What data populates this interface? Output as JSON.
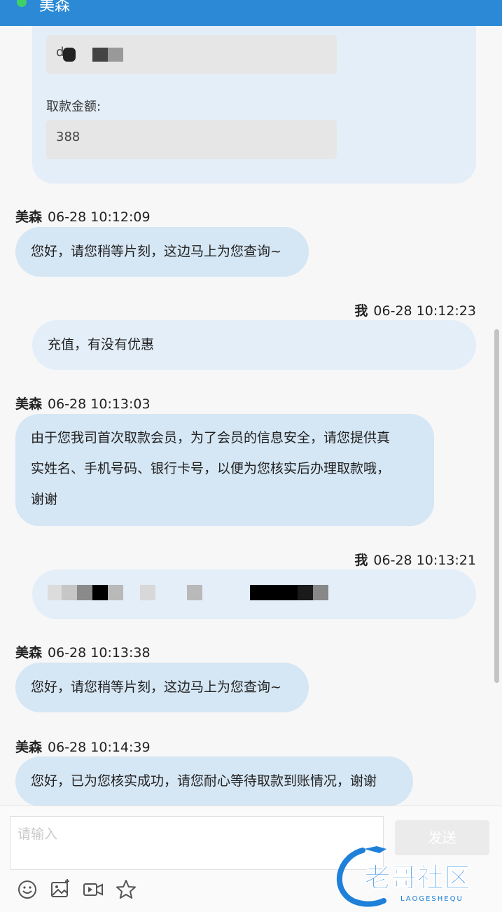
{
  "header": {
    "contact_name": "美森"
  },
  "form": {
    "account_value": "d",
    "amount_label": "取款金额:",
    "amount_value": "388"
  },
  "messages": [
    {
      "sender": "美森",
      "time": "06-28 10:12:09",
      "side": "left",
      "text": "您好，请您稍等片刻，这边马上为您查询~"
    },
    {
      "sender": "我",
      "time": "06-28 10:12:23",
      "side": "right",
      "text": "充值，有没有优惠"
    },
    {
      "sender": "美森",
      "time": "06-28 10:13:03",
      "side": "left",
      "lines": [
        "由于您我司首次取款会员，为了会员的信息安全，请您提供真",
        "实姓名、手机号码、银行卡号，以便为您核实后办理取款哦，",
        "谢谢"
      ]
    },
    {
      "sender": "我",
      "time": "06-28 10:13:21",
      "side": "right",
      "text": ""
    },
    {
      "sender": "美森",
      "time": "06-28 10:13:38",
      "side": "left",
      "text": "您好，请您稍等片刻，这边马上为您查询~"
    },
    {
      "sender": "美森",
      "time": "06-28 10:14:39",
      "side": "left",
      "text": "您好，已为您核实成功，请您耐心等待取款到账情况，谢谢"
    }
  ],
  "composer": {
    "placeholder": "请输入",
    "send_label": "发送"
  },
  "toolbar": {
    "icons": [
      "emoji-icon",
      "image-icon",
      "video-icon",
      "star-icon"
    ]
  },
  "watermark": {
    "text": "老哥社区",
    "subtext": "LAOGESHEQU"
  },
  "colors": {
    "header": "#2b89d6",
    "online": "#3fd068",
    "bubble_left": "#d5e6f4",
    "bubble_right": "#e3eef8"
  }
}
